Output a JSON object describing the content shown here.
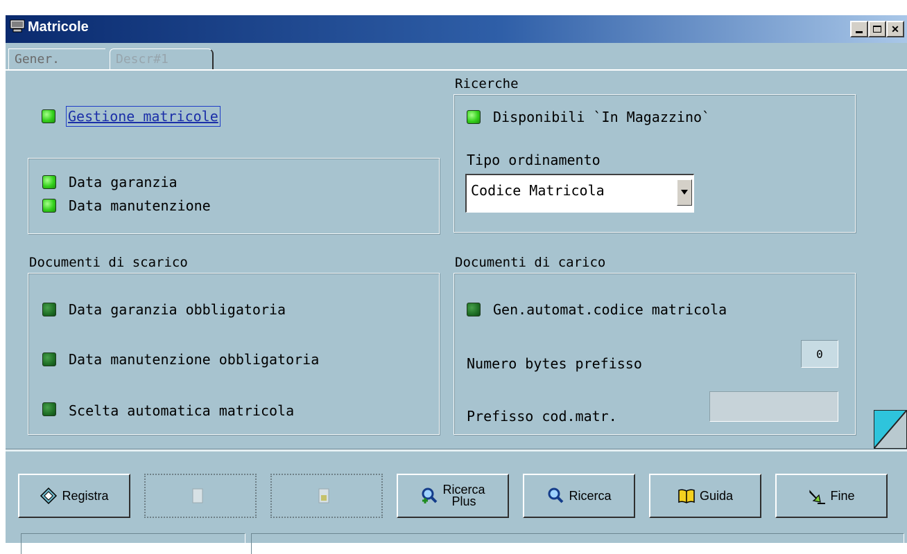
{
  "window": {
    "title": "Matricole",
    "icon": "app-window-icon"
  },
  "tabs": [
    {
      "label": "Gener.",
      "active": true
    },
    {
      "label": "Descr#1",
      "active": false
    }
  ],
  "left": {
    "gestione": {
      "label": "Gestione matricole",
      "checked": true
    },
    "date_group": [
      {
        "label": "Data garanzia",
        "checked": true
      },
      {
        "label": "Data manutenzione",
        "checked": true
      }
    ],
    "scarico": {
      "title": "Documenti di scarico",
      "items": [
        {
          "label": "Data garanzia obbligatoria",
          "checked": false
        },
        {
          "label": "Data manutenzione obbligatoria",
          "checked": false
        },
        {
          "label": "Scelta automatica matricola",
          "checked": false
        }
      ]
    }
  },
  "right": {
    "ricerche": {
      "title": "Ricerche",
      "disponibili": {
        "label": "Disponibili `In Magazzino`",
        "checked": true
      },
      "tipo_label": "Tipo ordinamento",
      "tipo_value": "Codice Matricola"
    },
    "carico": {
      "title": "Documenti di carico",
      "gen": {
        "label": "Gen.automat.codice matricola",
        "checked": false
      },
      "num_label": "Numero bytes prefisso",
      "num_value": "0",
      "prefisso_label": "Prefisso cod.matr.",
      "prefisso_value": ""
    }
  },
  "toolbar": {
    "registra": "Registra",
    "disabled1": "",
    "disabled2": "",
    "ricerca_plus_1": "Ricerca",
    "ricerca_plus_2": "Plus",
    "ricerca": "Ricerca",
    "guida": "Guida",
    "fine": "Fine"
  },
  "colors": {
    "background": "#a7c3cf",
    "led_on": "#34d01c",
    "led_off": "#1e6e25",
    "title_bar": "#0a2a6e"
  }
}
